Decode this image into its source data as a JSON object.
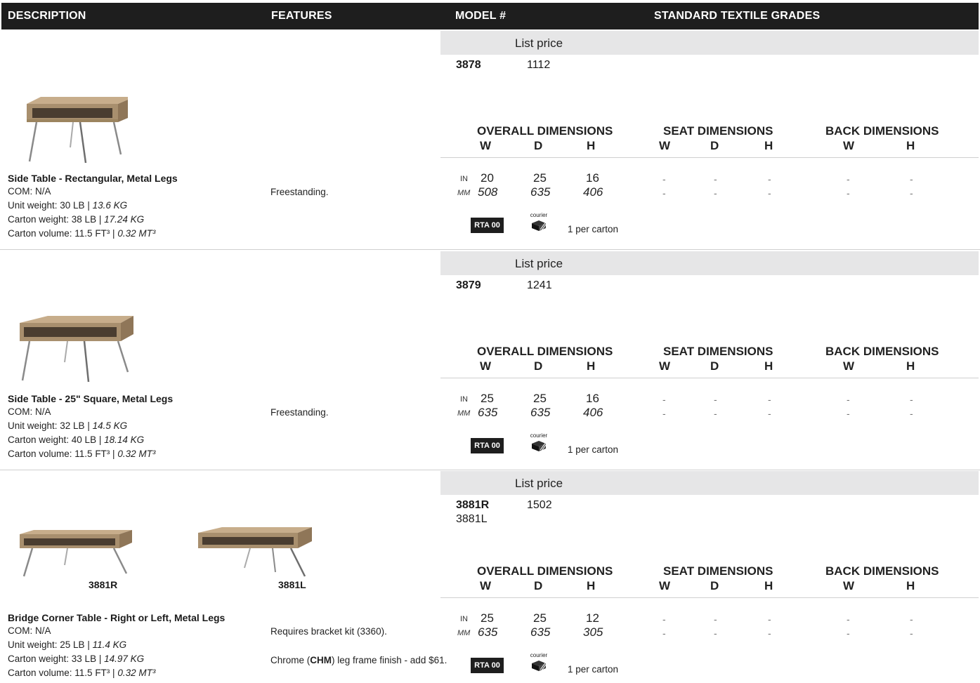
{
  "header": {
    "description": "DESCRIPTION",
    "features": "FEATURES",
    "model": "MODEL #",
    "grades": "STANDARD TEXTILE GRADES"
  },
  "common": {
    "list_price": "List price",
    "overall": "OVERALL DIMENSIONS",
    "seat": "SEAT DIMENSIONS",
    "back": "BACK DIMENSIONS",
    "w": "W",
    "d": "D",
    "h": "H",
    "in": "IN",
    "mm": "MM",
    "dash": "-",
    "rta": "RTA 00",
    "courier": "courier",
    "per_carton": "1 per carton"
  },
  "products": [
    {
      "model": "3878",
      "model_alt": "",
      "price": "1112",
      "title": "Side Table - Rectangular, Metal Legs",
      "com": "COM: N/A",
      "unit_weight": "Unit weight: 30 LB | ",
      "unit_weight_kg": "13.6 KG",
      "carton_weight": "Carton weight: 38 LB | ",
      "carton_weight_kg": "17.24 KG",
      "carton_volume": "Carton volume: 11.5 FT³ | ",
      "carton_volume_mt": "0.32 MT³",
      "features": [
        "Freestanding."
      ],
      "in": [
        "20",
        "25",
        "16"
      ],
      "mm": [
        "508",
        "635",
        "406"
      ]
    },
    {
      "model": "3879",
      "model_alt": "",
      "price": "1241",
      "title": "Side Table - 25\" Square, Metal Legs",
      "com": "COM: N/A",
      "unit_weight": "Unit weight: 32 LB | ",
      "unit_weight_kg": "14.5 KG",
      "carton_weight": "Carton weight: 40 LB | ",
      "carton_weight_kg": "18.14 KG",
      "carton_volume": "Carton volume: 11.5 FT³ | ",
      "carton_volume_mt": "0.32 MT³",
      "features": [
        "Freestanding."
      ],
      "in": [
        "25",
        "25",
        "16"
      ],
      "mm": [
        "635",
        "635",
        "406"
      ]
    },
    {
      "model": "3881R",
      "model_alt": "3881L",
      "price": "1502",
      "title": "Bridge Corner Table - Right or Left, Metal Legs",
      "com": "COM: N/A",
      "unit_weight": "Unit weight: 25 LB | ",
      "unit_weight_kg": "11.4 KG",
      "carton_weight": "Carton weight: 33 LB | ",
      "carton_weight_kg": "14.97 KG",
      "carton_volume": "Carton volume: 11.5 FT³ | ",
      "carton_volume_mt": "0.32 MT³",
      "features": [
        "Requires bracket kit (3360)."
      ],
      "feature2_pre": "Chrome (",
      "feature2_bold": "CHM",
      "feature2_post": ") leg frame finish - add $61.",
      "thumb_labels": [
        "3881R",
        "3881L"
      ],
      "in": [
        "25",
        "25",
        "12"
      ],
      "mm": [
        "635",
        "635",
        "305"
      ]
    }
  ],
  "colors": {
    "header_bg": "#1e1e1e",
    "band_bg": "#e6e6e7",
    "wood": "#a88f6e"
  }
}
